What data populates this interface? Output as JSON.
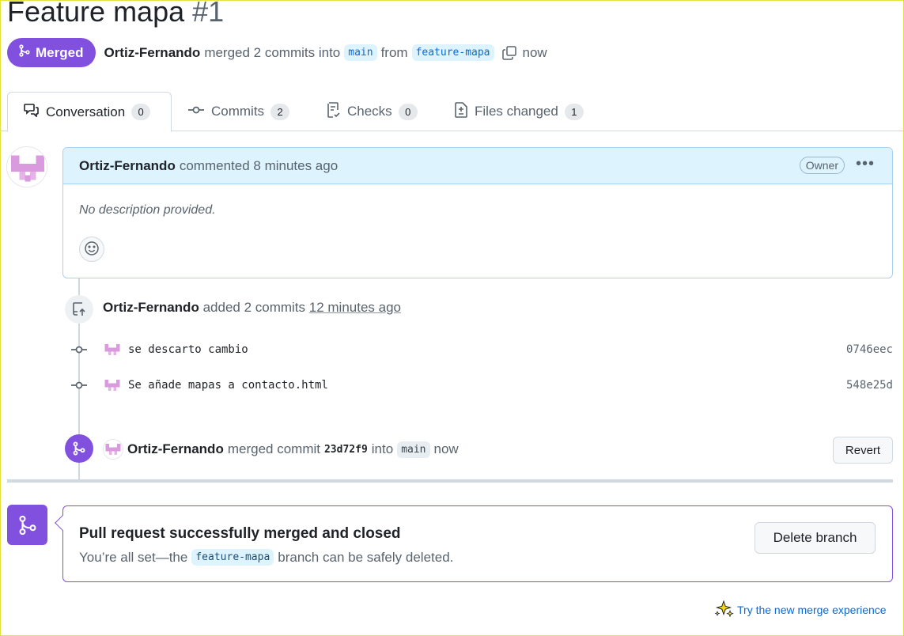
{
  "pr": {
    "title": "Feature mapa",
    "number": "#1",
    "status": "Merged",
    "author": "Ortiz-Fernando",
    "merge_summary": "merged 2 commits into",
    "base_branch": "main",
    "from_word": "from",
    "head_branch": "feature-mapa",
    "time": "now"
  },
  "tabs": [
    {
      "label": "Conversation",
      "count": "0"
    },
    {
      "label": "Commits",
      "count": "2"
    },
    {
      "label": "Checks",
      "count": "0"
    },
    {
      "label": "Files changed",
      "count": "1"
    }
  ],
  "comment": {
    "author": "Ortiz-Fernando",
    "action": "commented 8 minutes ago",
    "badge": "Owner",
    "body": "No description provided."
  },
  "commits_event": {
    "author": "Ortiz-Fernando",
    "action": "added 2 commits",
    "time": "12 minutes ago",
    "commits": [
      {
        "message": "se descarto cambio",
        "sha": "0746eec"
      },
      {
        "message": "Se añade mapas a contacto.html",
        "sha": "548e25d"
      }
    ]
  },
  "merge_event": {
    "author": "Ortiz-Fernando",
    "action": "merged commit",
    "sha": "23d72f9",
    "into_word": "into",
    "branch": "main",
    "time": "now",
    "revert_label": "Revert"
  },
  "merge_box": {
    "heading": "Pull request successfully merged and closed",
    "sub_prefix": "You’re all set—the",
    "branch": "feature-mapa",
    "sub_suffix": "branch can be safely deleted.",
    "delete_label": "Delete branch"
  },
  "footer": {
    "try_label": "Try the new merge experience"
  },
  "colors": {
    "merged_purple": "#8250df",
    "link_blue": "#0969da",
    "comment_header_bg": "#ddf4ff"
  }
}
